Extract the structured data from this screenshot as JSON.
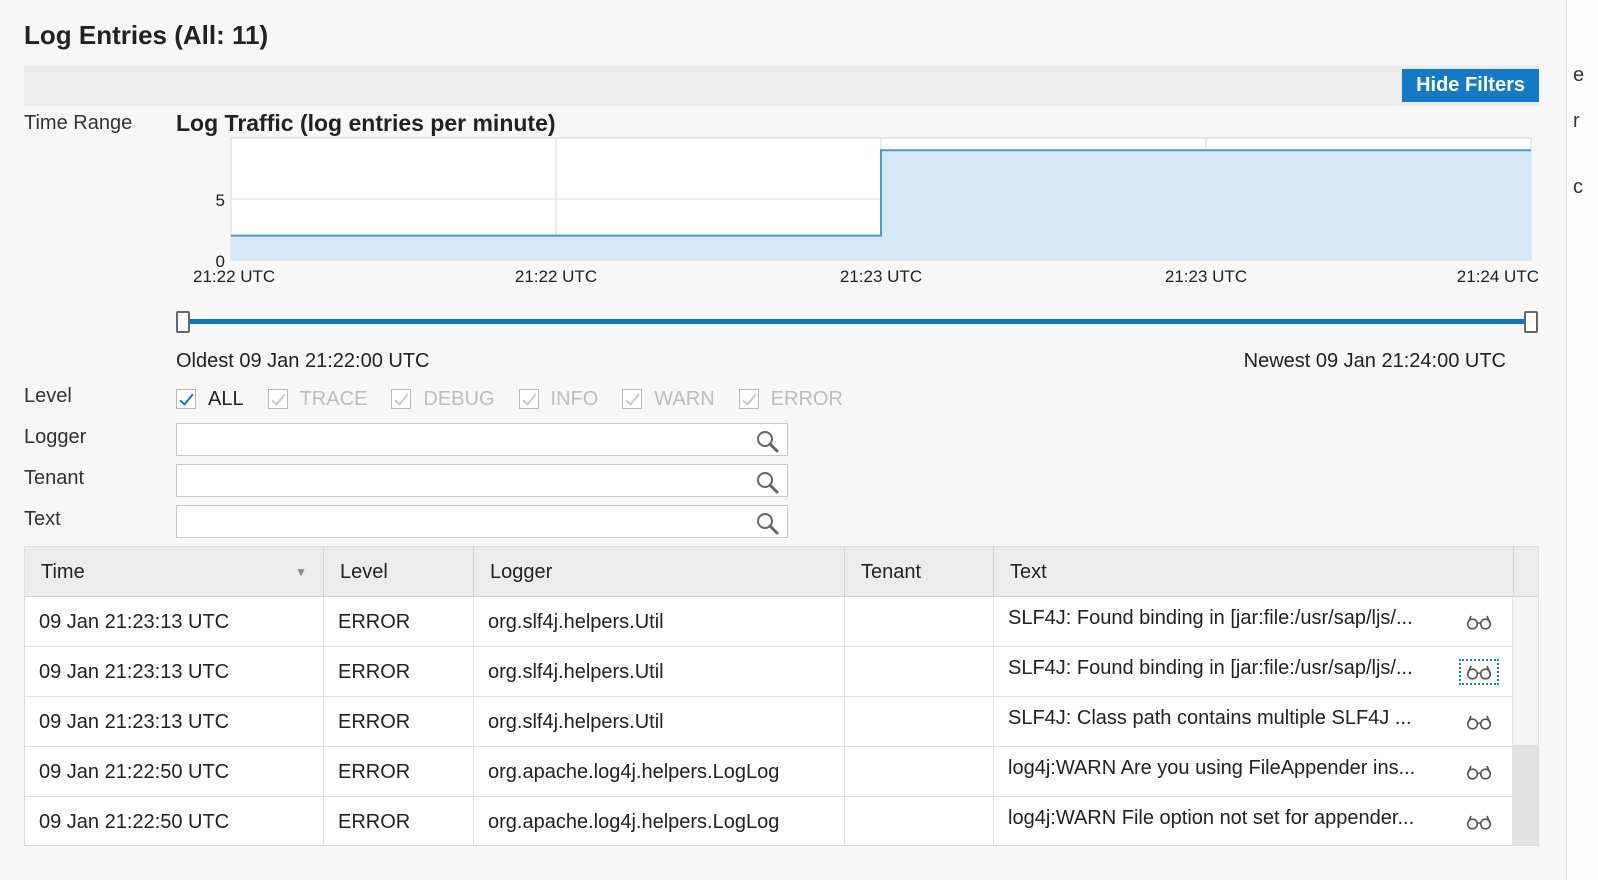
{
  "title": "Log Entries (All: 11)",
  "hide_filters_label": "Hide Filters",
  "labels": {
    "time_range": "Time Range",
    "level": "Level",
    "logger": "Logger",
    "tenant": "Tenant",
    "text": "Text"
  },
  "chart_data": {
    "type": "area",
    "title": "Log Traffic (log entries per minute)",
    "x_tick_labels": [
      "21:22 UTC",
      "21:22 UTC",
      "21:23 UTC",
      "21:23 UTC",
      "21:24 UTC"
    ],
    "x": [
      "21:22:00",
      "21:22:30",
      "21:23:00",
      "21:23:30",
      "21:24:00"
    ],
    "y_ticks": [
      0,
      5
    ],
    "ylim": [
      0,
      10
    ],
    "values": [
      2,
      2,
      9,
      9,
      9
    ],
    "step": true,
    "grid": true,
    "fill_color": "#d6e7f5",
    "line_color": "#4a9ad6"
  },
  "time_range": {
    "oldest": "Oldest 09 Jan 21:22:00 UTC",
    "newest": "Newest 09 Jan 21:24:00 UTC"
  },
  "levels": [
    {
      "label": "ALL",
      "checked": true,
      "active": true
    },
    {
      "label": "TRACE",
      "checked": true,
      "active": false
    },
    {
      "label": "DEBUG",
      "checked": true,
      "active": false
    },
    {
      "label": "INFO",
      "checked": true,
      "active": false
    },
    {
      "label": "WARN",
      "checked": true,
      "active": false
    },
    {
      "label": "ERROR",
      "checked": true,
      "active": false
    }
  ],
  "filters": {
    "logger_value": "",
    "tenant_value": "",
    "text_value": ""
  },
  "table": {
    "columns": [
      "Time",
      "Level",
      "Logger",
      "Tenant",
      "Text"
    ],
    "rows": [
      {
        "time": "09 Jan 21:23:13 UTC",
        "level": "ERROR",
        "logger": "org.slf4j.helpers.Util",
        "tenant": "",
        "text": "SLF4J: Found binding in [jar:file:/usr/sap/ljs/..."
      },
      {
        "time": "09 Jan 21:23:13 UTC",
        "level": "ERROR",
        "logger": "org.slf4j.helpers.Util",
        "tenant": "",
        "text": "SLF4J: Found binding in [jar:file:/usr/sap/ljs/..."
      },
      {
        "time": "09 Jan 21:23:13 UTC",
        "level": "ERROR",
        "logger": "org.slf4j.helpers.Util",
        "tenant": "",
        "text": "SLF4J: Class path contains multiple SLF4J ..."
      },
      {
        "time": "09 Jan 21:22:50 UTC",
        "level": "ERROR",
        "logger": "org.apache.log4j.helpers.LogLog",
        "tenant": "",
        "text": "log4j:WARN Are you using FileAppender ins..."
      },
      {
        "time": "09 Jan 21:22:50 UTC",
        "level": "ERROR",
        "logger": "org.apache.log4j.helpers.LogLog",
        "tenant": "",
        "text": "log4j:WARN File option not set for appender..."
      }
    ]
  },
  "icons": {
    "search": "magnifier-icon",
    "details": "glasses-icon",
    "sort": "sort-icon"
  },
  "colors": {
    "accent": "#1679c6"
  }
}
